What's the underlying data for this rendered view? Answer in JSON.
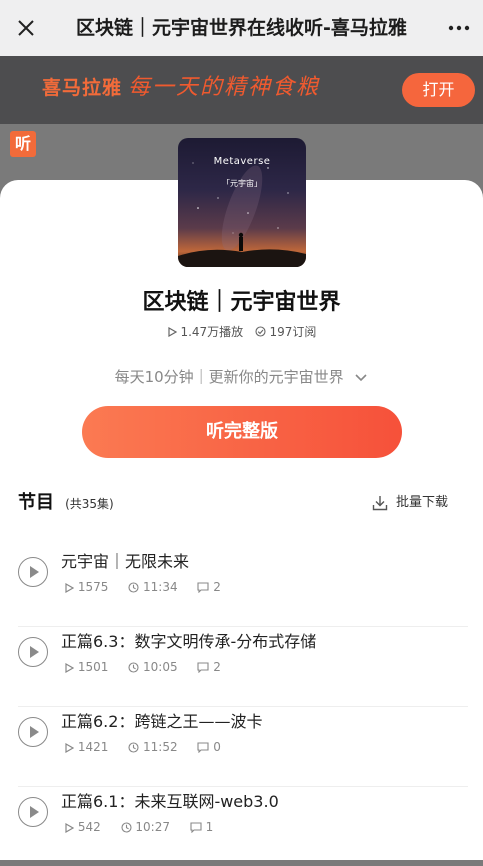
{
  "topbar": {
    "title": "区块链｜元宇宙世界在线收听-喜马拉雅"
  },
  "banner": {
    "logo_glyph": "听",
    "brand": "喜马拉雅",
    "slogan": "每一天的精神食粮",
    "open_label": "打开"
  },
  "album": {
    "cover_title": "Metaverse",
    "cover_subtitle": "「元宇宙」",
    "title": "区块链｜元宇宙世界",
    "plays": "1.47万播放",
    "subscriptions": "197订阅",
    "description": "每天10分钟｜更新你的元宇宙世界",
    "listen_label": "听完整版"
  },
  "programs": {
    "heading": "节目",
    "count": "(共35集)",
    "batch_download": "批量下载"
  },
  "episodes": [
    {
      "title": "元宇宙｜无限未来",
      "plays": "1575",
      "duration": "11:34",
      "comments": "2"
    },
    {
      "title": "正篇6.3：数字文明传承-分布式存储",
      "plays": "1501",
      "duration": "10:05",
      "comments": "2"
    },
    {
      "title": "正篇6.2：跨链之王——波卡",
      "plays": "1421",
      "duration": "11:52",
      "comments": "0"
    },
    {
      "title": "正篇6.1：未来互联网-web3.0",
      "plays": "542",
      "duration": "10:27",
      "comments": "1"
    }
  ],
  "colors": {
    "accent": "#f5663d",
    "banner_bg": "#4d4d4f",
    "topbar_bg": "#efeff0"
  }
}
